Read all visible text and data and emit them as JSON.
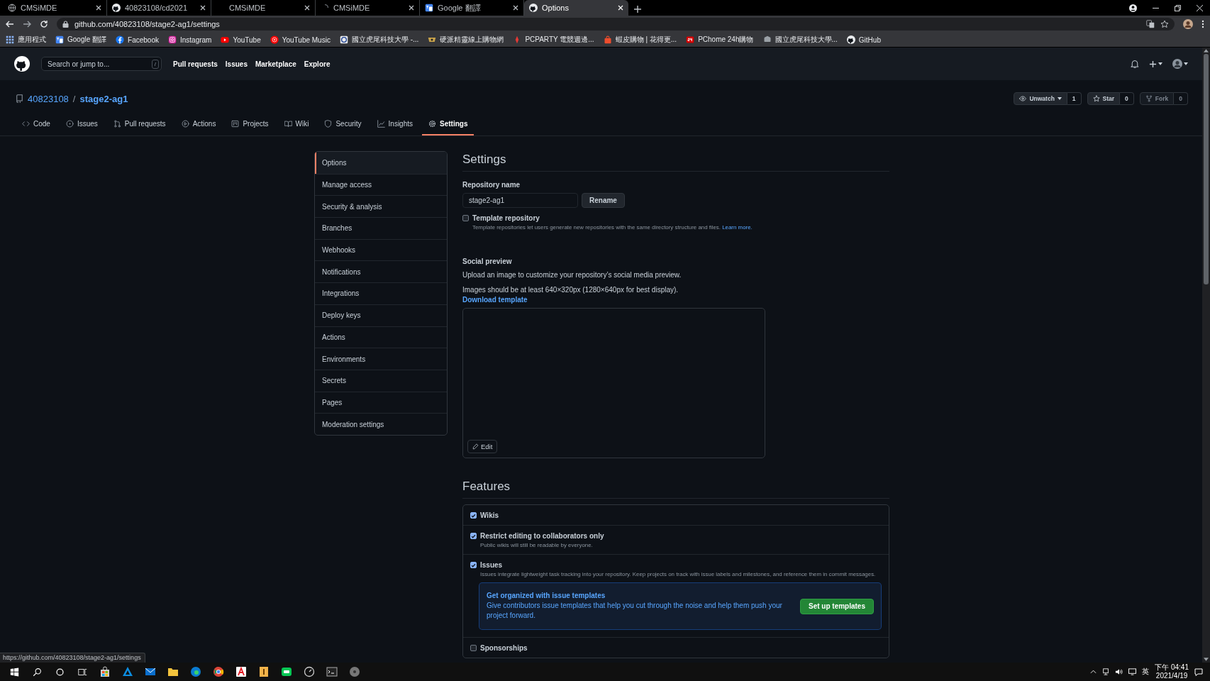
{
  "browser": {
    "tabs": [
      {
        "title": "CMSiMDE",
        "kind": "globe",
        "selected": false
      },
      {
        "title": "40823108/cd2021",
        "kind": "github",
        "selected": false
      },
      {
        "title": "CMSiMDE",
        "kind": "none",
        "selected": false
      },
      {
        "title": "CMSiMDE",
        "kind": "loading",
        "selected": false
      },
      {
        "title": "Google 翻譯",
        "kind": "translate",
        "selected": false
      },
      {
        "title": "Options",
        "kind": "github",
        "selected": true
      }
    ],
    "address": "github.com/40823108/stage2-ag1/settings",
    "bookmarks": [
      {
        "label": "應用程式",
        "kind": "apps"
      },
      {
        "label": "Google 翻譯",
        "kind": "translate"
      },
      {
        "label": "Facebook",
        "kind": "facebook"
      },
      {
        "label": "Instagram",
        "kind": "instagram"
      },
      {
        "label": "YouTube",
        "kind": "youtube"
      },
      {
        "label": "YouTube Music",
        "kind": "music"
      },
      {
        "label": "國立虎尾科技大學 -...",
        "kind": "school"
      },
      {
        "label": "硬派精靈線上購物網",
        "kind": "shop"
      },
      {
        "label": "PCPARTY 電競週邊...",
        "kind": "pcparty"
      },
      {
        "label": "蝦皮購物 | 花得更...",
        "kind": "shopee"
      },
      {
        "label": "PChome 24h購物",
        "kind": "pchome"
      },
      {
        "label": "國立虎尾科技大學...",
        "kind": "school2"
      },
      {
        "label": "GitHub",
        "kind": "github"
      }
    ]
  },
  "github_header": {
    "search": {
      "placeholder": "Search or jump to..."
    },
    "shortcut_key": "/",
    "nav": [
      "Pull requests",
      "Issues",
      "Marketplace",
      "Explore"
    ]
  },
  "repo": {
    "owner": "40823108",
    "separator": "/",
    "name": "stage2-ag1",
    "actions": [
      {
        "kind": "watch",
        "label": "Unwatch",
        "count": "1",
        "disabled": false
      },
      {
        "kind": "star",
        "label": "Star",
        "count": "0",
        "disabled": false
      },
      {
        "kind": "fork",
        "label": "Fork",
        "count": "0",
        "disabled": true
      }
    ],
    "tabs": [
      {
        "label": "Code",
        "kind": "code",
        "selected": false
      },
      {
        "label": "Issues",
        "kind": "issues",
        "selected": false
      },
      {
        "label": "Pull requests",
        "kind": "pulls",
        "selected": false
      },
      {
        "label": "Actions",
        "kind": "actions",
        "selected": false
      },
      {
        "label": "Projects",
        "kind": "projects",
        "selected": false
      },
      {
        "label": "Wiki",
        "kind": "wiki",
        "selected": false
      },
      {
        "label": "Security",
        "kind": "security",
        "selected": false
      },
      {
        "label": "Insights",
        "kind": "insights",
        "selected": false
      },
      {
        "label": "Settings",
        "kind": "settings",
        "selected": true
      }
    ]
  },
  "sidebar": {
    "items": [
      {
        "label": "Options",
        "selected": true
      },
      {
        "label": "Manage access",
        "selected": false
      },
      {
        "label": "Security & analysis",
        "selected": false
      },
      {
        "label": "Branches",
        "selected": false
      },
      {
        "label": "Webhooks",
        "selected": false
      },
      {
        "label": "Notifications",
        "selected": false
      },
      {
        "label": "Integrations",
        "selected": false
      },
      {
        "label": "Deploy keys",
        "selected": false
      },
      {
        "label": "Actions",
        "selected": false
      },
      {
        "label": "Environments",
        "selected": false
      },
      {
        "label": "Secrets",
        "selected": false
      },
      {
        "label": "Pages",
        "selected": false
      },
      {
        "label": "Moderation settings",
        "selected": false
      }
    ]
  },
  "settings": {
    "title": "Settings",
    "repository_name": {
      "label": "Repository name",
      "value": "stage2-ag1",
      "button": "Rename"
    },
    "template_repository": {
      "label": "Template repository",
      "checked": false,
      "description": "Template repositories let users generate new repositories with the same directory structure and files.",
      "link": "Learn more."
    },
    "social_preview": {
      "title": "Social preview",
      "description": "Upload an image to customize your repository’s social media preview.",
      "requirements": "Images should be at least 640×320px (1280×640px for best display).",
      "link": "Download template",
      "edit_button": "Edit"
    },
    "features": {
      "title": "Features",
      "items": [
        {
          "label": "Wikis",
          "checked": true
        },
        {
          "label": "Restrict editing to collaborators only",
          "checked": true,
          "description": "Public wikis will still be readable by everyone."
        },
        {
          "label": "Issues",
          "checked": true,
          "description": "Issues integrate lightweight task tracking into your repository. Keep projects on track with issue labels and milestones, and reference them in commit messages.",
          "callout": {
            "title": "Get organized with issue templates",
            "text": "Give contributors issue templates that help you cut through the noise and help them push your project forward.",
            "button": "Set up templates"
          }
        },
        {
          "label": "Sponsorships",
          "checked": false
        }
      ]
    }
  },
  "status_url": "https://github.com/40823108/stage2-ag1/settings",
  "taskbar": {
    "ime": "英",
    "time": "下午 04:41",
    "date": "2021/4/19"
  }
}
